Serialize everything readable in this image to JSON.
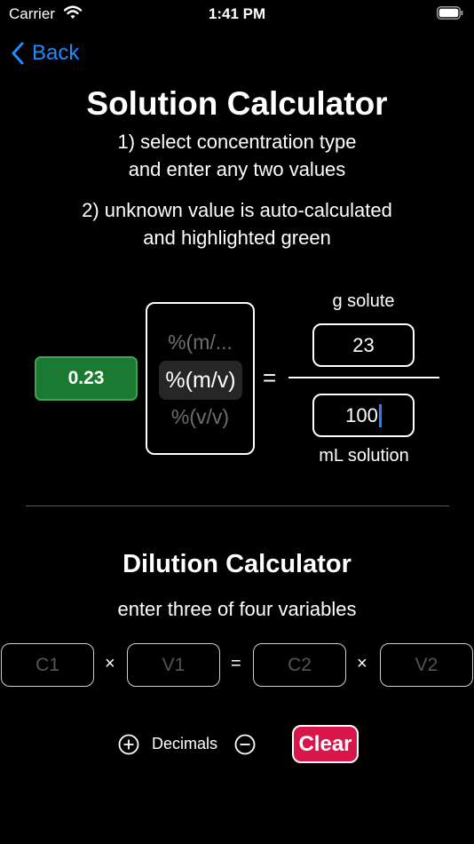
{
  "status_bar": {
    "carrier": "Carrier",
    "time": "1:41 PM"
  },
  "nav": {
    "back_label": "Back"
  },
  "solution": {
    "title": "Solution Calculator",
    "instruction_1_line_1": "1) select concentration type",
    "instruction_1_line_2": "and enter any two values",
    "instruction_2_line_1": "2) unknown value is auto-calculated",
    "instruction_2_line_2": "and highlighted green",
    "result_value": "0.23",
    "picker_options": [
      "%(m/...",
      "%(m/v)",
      "%(v/v)"
    ],
    "picker_selected": "%(m/v)",
    "equals": "=",
    "numerator_label": "g solute",
    "numerator_value": "23",
    "denominator_value": "100",
    "denominator_label": "mL solution",
    "highlight_color": "#1b7a31"
  },
  "dilution": {
    "title": "Dilution Calculator",
    "subtitle": "enter three of four variables",
    "c1_placeholder": "C1",
    "v1_placeholder": "V1",
    "c2_placeholder": "C2",
    "v2_placeholder": "V2",
    "times": "×",
    "equals": "="
  },
  "controls": {
    "decimals_label": "Decimals",
    "clear_label": "Clear",
    "clear_color": "#d9164a"
  },
  "colors": {
    "accent": "#1e8bff",
    "caret": "#2b7cff"
  },
  "icons": [
    "wifi-icon",
    "battery-icon",
    "chevron-left-icon",
    "plus-circle-icon",
    "minus-circle-icon"
  ]
}
